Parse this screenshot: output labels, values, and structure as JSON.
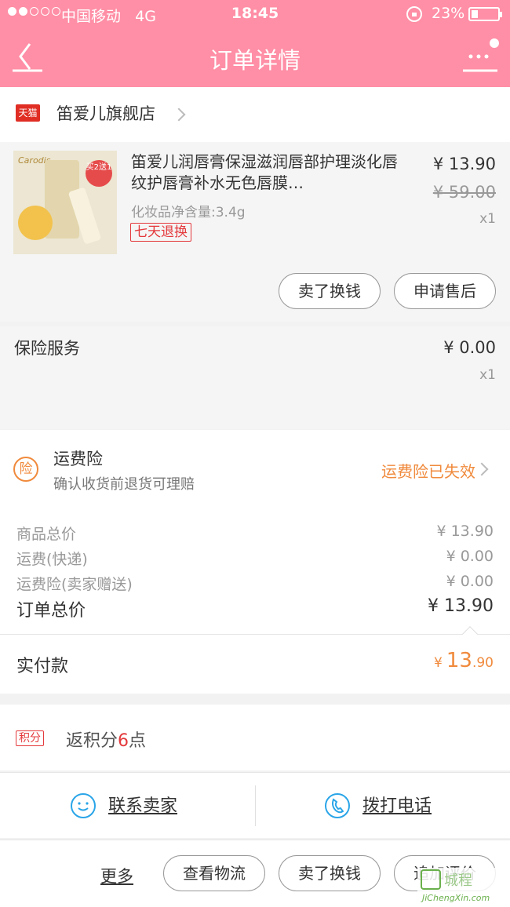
{
  "status_bar": {
    "carrier": "中国移动",
    "network": "4G",
    "time": "18:45",
    "battery": "23%"
  },
  "nav": {
    "title": "订单详情"
  },
  "shop": {
    "badge": "天猫",
    "name": "笛爱儿旗舰店"
  },
  "product": {
    "thumb_brand": "Carodis",
    "thumb_badge": "买2送1",
    "title": "笛爱儿润唇膏保湿滋润唇部护理淡化唇纹护唇膏补水无色唇膜…",
    "spec": "化妆品净含量:3.4g",
    "tag": "七天退换",
    "price": "¥ 13.90",
    "original_price": "¥ 59.00",
    "qty": "x1",
    "buttons": {
      "sell": "卖了换钱",
      "aftersale": "申请售后"
    }
  },
  "insurance": {
    "label": "保险服务",
    "amount": "¥ 0.00",
    "qty": "x1"
  },
  "freight_insurance": {
    "icon": "险",
    "title": "运费险",
    "subtitle": "确认收货前退货可理赔",
    "state": "运费险已失效"
  },
  "summary": {
    "goods_total_label": "商品总价",
    "goods_total": "¥ 13.90",
    "shipping_label": "运费(快递)",
    "shipping": "¥ 0.00",
    "shipping_ins_label": "运费险(卖家赠送)",
    "shipping_ins": "¥ 0.00",
    "order_total_label": "订单总价",
    "order_total": "¥ 13.90"
  },
  "paid": {
    "label": "实付款",
    "currency": "¥",
    "int": "13",
    "dec": ".90"
  },
  "points": {
    "badge": "积分",
    "prefix": "返积分",
    "count": "6",
    "suffix": "点"
  },
  "contact": {
    "seller": "联系卖家",
    "call": "拨打电话"
  },
  "bottom_bar": {
    "more": "更多",
    "logistics": "查看物流",
    "sell": "卖了换钱",
    "review": "追加评价"
  },
  "watermark": {
    "text": "城程",
    "url": "JiChengXin.com"
  },
  "colors": {
    "header": "#ff8fa6",
    "accent_orange": "#f08a3c",
    "accent_red": "#e4393c",
    "icon_blue": "#2aa5e8"
  }
}
